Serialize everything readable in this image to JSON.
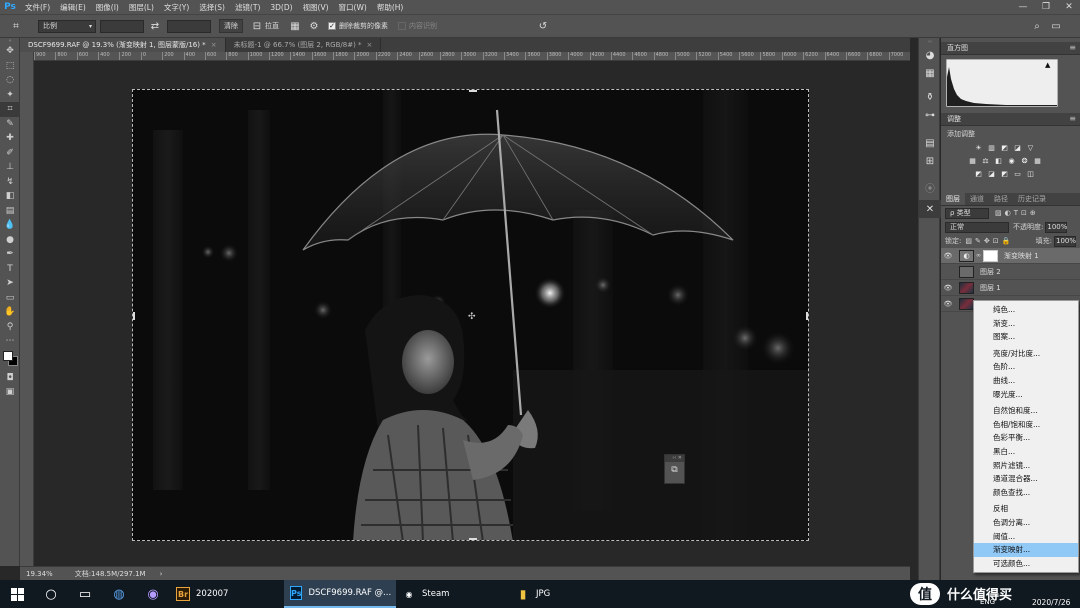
{
  "app": {
    "logo": "Ps",
    "menus": [
      "文件(F)",
      "编辑(E)",
      "图像(I)",
      "图层(L)",
      "文字(Y)",
      "选择(S)",
      "滤镜(T)",
      "3D(D)",
      "视图(V)",
      "窗口(W)",
      "帮助(H)"
    ]
  },
  "options": {
    "ratio": "比例",
    "straighten": "拉直",
    "delete_cropped_label": "删除裁剪的像素",
    "content_aware_label": "内容识别",
    "clear": "清除"
  },
  "tabs": [
    {
      "label": "DSCF9699.RAF @ 19.3% (渐变映射 1, 图层蒙版/16) *",
      "close": "×"
    },
    {
      "label": "未标题-1 @ 66.7% (图层 2, RGB/8#) *",
      "close": "×"
    }
  ],
  "ruler": {
    "h": [
      "900",
      "800",
      "600",
      "400",
      "200",
      "0",
      "200",
      "400",
      "600",
      "800",
      "1000",
      "1200",
      "1400",
      "1600",
      "1800",
      "2000",
      "2200",
      "2400",
      "2600",
      "2800",
      "3000",
      "3200",
      "3400",
      "3600",
      "3800",
      "4000",
      "4200",
      "4400",
      "4600",
      "4800",
      "5000",
      "5200",
      "5400",
      "5600",
      "5800",
      "6000",
      "6200",
      "6400",
      "6600",
      "6800",
      "7000"
    ]
  },
  "status": {
    "zoom": "19.34%",
    "doc": "文档:148.5M/297.1M"
  },
  "panels": {
    "histogram": {
      "title": "直方图",
      "warning": "▲"
    },
    "adjustments": {
      "title": "调整",
      "add_label": "添加调整"
    },
    "layers": {
      "tabs": [
        "图层",
        "通道",
        "路径",
        "历史记录"
      ],
      "filter_label": "ρ 类型",
      "blend_mode": "正常",
      "opacity_label": "不透明度:",
      "opacity_value": "100%",
      "lock_label": "锁定:",
      "fill_label": "填充:",
      "fill_value": "100%",
      "items": [
        {
          "name": "渐变映射 1"
        },
        {
          "name": "图层 2"
        },
        {
          "name": "图层 1"
        },
        {
          "name": ""
        }
      ]
    }
  },
  "context_menu": {
    "items": [
      "纯色...",
      "渐变...",
      "图案...",
      "---",
      "亮度/对比度...",
      "色阶...",
      "曲线...",
      "曝光度...",
      "---",
      "自然饱和度...",
      "色相/饱和度...",
      "色彩平衡...",
      "黑白...",
      "照片滤镜...",
      "通道混合器...",
      "颜色查找...",
      "---",
      "反相",
      "色调分离...",
      "阈值...",
      "渐变映射...",
      "可选颜色..."
    ],
    "highlighted": "渐变映射..."
  },
  "taskbar": {
    "apps": [
      {
        "label": "202007",
        "icon": "Br"
      },
      {
        "label": "DSCF9699.RAF @...",
        "icon": "Ps"
      },
      {
        "label": "Steam",
        "icon": "◉"
      },
      {
        "label": "JPG",
        "icon": "▮"
      }
    ],
    "lang": "ENG",
    "date": "2020/7/26",
    "brand_text": "什么值得买"
  },
  "colors": {
    "ps_blue": "#31a8ff",
    "bridge_orange": "#e8a33d",
    "menu_highlight": "#90c8f6"
  }
}
